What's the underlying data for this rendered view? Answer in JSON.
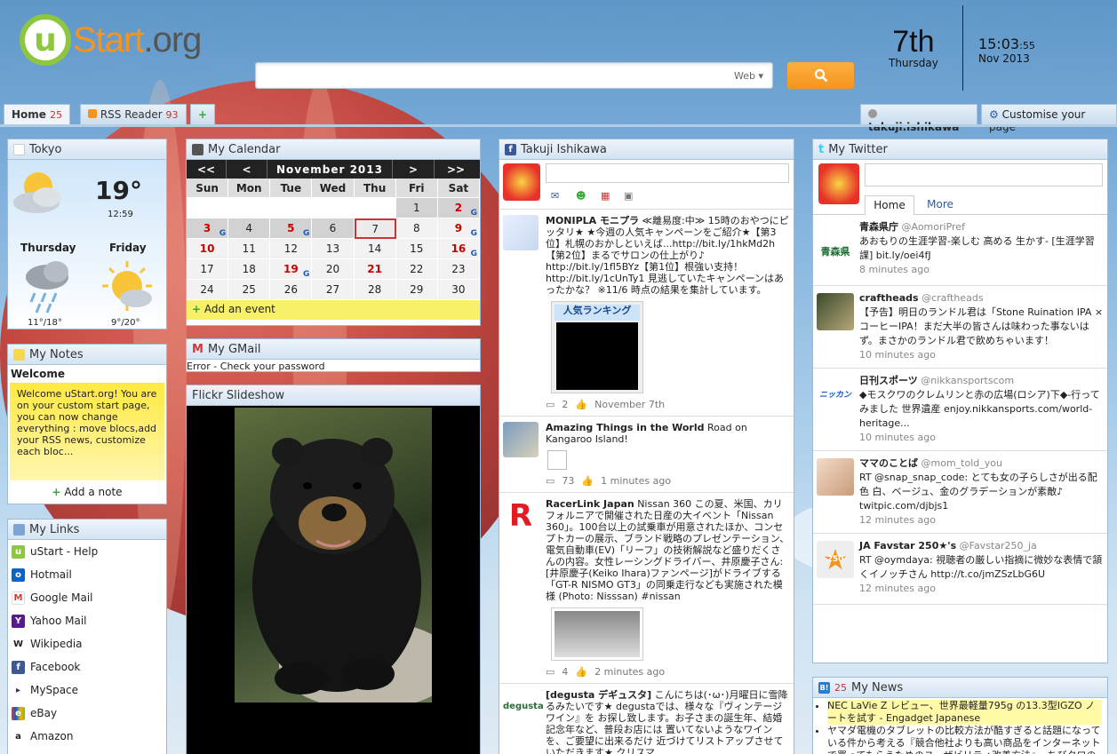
{
  "brand": {
    "logo_u": "u",
    "logo_start": "Start",
    "logo_org": ".org"
  },
  "search": {
    "placeholder": "",
    "engine_label": "Web ▾"
  },
  "date": {
    "day_num": "7th",
    "weekday": "Thursday",
    "time": "15:03",
    "seconds": ":55",
    "month_year": "Nov 2013"
  },
  "tabs": [
    {
      "label": "Home",
      "count": "25"
    },
    {
      "label": "RSS Reader",
      "count": "93"
    },
    {
      "label": "+"
    }
  ],
  "user": {
    "name": "takuji.ishikawa",
    "customise_label": "Customise your page"
  },
  "weather": {
    "title": "Tokyo",
    "current_temp": "19°",
    "current_time": "12:59",
    "days": [
      {
        "name": "Thursday",
        "temps": "11°/18°"
      },
      {
        "name": "Friday",
        "temps": "9°/20°"
      }
    ]
  },
  "calendar": {
    "title": "My Calendar",
    "nav": {
      "prev_year": "<<",
      "prev": "<",
      "month": "November 2013",
      "next": ">",
      "next_year": ">>"
    },
    "dows": [
      "Sun",
      "Mon",
      "Tue",
      "Wed",
      "Thu",
      "Fri",
      "Sat"
    ],
    "add_event": "Add an event"
  },
  "gmail": {
    "title": "My GMail",
    "error": "Error - Check your password"
  },
  "flickr": {
    "title": "Flickr Slideshow"
  },
  "notes": {
    "title": "My Notes",
    "note_title": "Welcome",
    "note_text": "Welcome uStart.org! You are on your custom start page, you can now change everything : move blocs,add your RSS news, customize each bloc...",
    "add": "Add a note"
  },
  "links": {
    "title": "My Links",
    "items": [
      {
        "label": "uStart - Help",
        "icon": "u"
      },
      {
        "label": "Hotmail",
        "icon": "o"
      },
      {
        "label": "Google Mail",
        "icon": "M"
      },
      {
        "label": "Yahoo Mail",
        "icon": "Y"
      },
      {
        "label": "Wikipedia",
        "icon": "W"
      },
      {
        "label": "Facebook",
        "icon": "f"
      },
      {
        "label": "MySpace",
        "icon": "▸"
      },
      {
        "label": "eBay",
        "icon": "e"
      },
      {
        "label": "Amazon",
        "icon": "a"
      }
    ]
  },
  "facebook": {
    "title": "Takuji Ishikawa",
    "posts": [
      {
        "name": "MONIPLA モニプラ",
        "text": "≪離易度:中≫ 15時のおやつにピッタリ★ ★今週の人気キャンペーンをご紹介★【第3位】札幌のおかしといえば...http://bit.ly/1hkMd2h【第2位】まるでサロンの仕上がり♪ http://bit.ly/1fl5BYz【第1位】根強い支持！http://bit.ly/1cUnTy1 見逃していたキャンペーンはあったかな？ ※11/6 時点の結果を集計しています。",
        "comments": "2",
        "time": "November 7th",
        "thumb_label": "人気ランキング"
      },
      {
        "name": "Amazing Things in the World",
        "text": "Road on Kangaroo Island!",
        "comments": "73",
        "time": "1 minutes ago"
      },
      {
        "name": "RacerLink Japan",
        "text": "Nissan 360 この夏、米国、カリフォルニアで開催された日産の大イベント「Nissan 360」。100台以上の試乗車が用意されたほか、コンセプトカーの展示、ブランド戦略のプレゼンテーション、電気自動車(EV)「リーフ」の技術解説など盛りだくさんの内容。女性レーシングドライバー、井原慶子さん:[井原慶子(Keiko Ihara)ファンページ]がドライブする「GT-R NISMO GT3」の同乗走行なども実施された模様 (Photo: Nisssan) #nissan",
        "comments": "4",
        "time": "2 minutes ago"
      },
      {
        "name": "[degusta デギュスタ]",
        "text": "こんにちは(･ω･)月曜日に雪降るみたいです★ degustaでは、様々な『ヴィンテージワイン』を お探し致します。お子さまの誕生年、結婚記念年など、普段お店には 置いてないようなワインを、ご要望に出来るだけ 近づけてリストアップさせていただきます★ クリスマ",
        "comments": "",
        "time": ""
      }
    ]
  },
  "twitter": {
    "title": "My Twitter",
    "tabs": [
      "Home",
      "More"
    ],
    "posts": [
      {
        "name": "青森県庁",
        "handle": "@AomoriPref",
        "text": "あおもりの生涯学習-楽しむ 高める 生かす- [生涯学習課] bit.ly/oei4fJ",
        "time": "8 minutes ago",
        "avatar_text": "青森県"
      },
      {
        "name": "craftheads",
        "handle": "@craftheads",
        "text": "【予告】明日のランドル君は「Stone Ruination IPA × コーヒーIPA！まだ大半の皆さんは味わった事ないはず。まさかのランドル君で飲めちゃいます！",
        "time": "10 minutes ago"
      },
      {
        "name": "日刊スポーツ",
        "handle": "@nikkansportscom",
        "text": "◆モスクワのクレムリンと赤の広場(ロシア)下◆-行ってみました 世界遺産 enjoy.nikkansports.com/world-heritage...",
        "time": "10 minutes ago",
        "avatar_text": "ニッカン"
      },
      {
        "name": "ママのことば",
        "handle": "@mom_told_you",
        "text": "RT @snap_snap_code: とても女の子らしさが出る配色 白、ベージュ、金のグラデーションが素敵♪ twitpic.com/djbjs1",
        "time": "12 minutes ago"
      },
      {
        "name": "JA Favstar 250★'s",
        "handle": "@Favstar250_ja",
        "text": "RT @oymdaya: 視聴者の厳しい指摘に微妙な表情で頷くイノッチさん http://t.co/jmZSzLbG6U",
        "time": "12 minutes ago",
        "avatar_text": "250"
      }
    ]
  },
  "news": {
    "title": "My News",
    "count": "25",
    "items": [
      "NEC LaVie Z レビュー、世界最軽量795g の13.3型IGZO ノートを試す - Engadget Japanese",
      "ヤマダ電機のタブレットの比較方法が酷すぎると話題になっている件から考える『競合他社よりも高い商品をインターネットで買ってもらうためのユーザビリティ改善方法』- ちびクロの"
    ]
  },
  "colors": {
    "accent": "#f7941d",
    "brand_green": "#8dc63f",
    "red": "#c00"
  }
}
